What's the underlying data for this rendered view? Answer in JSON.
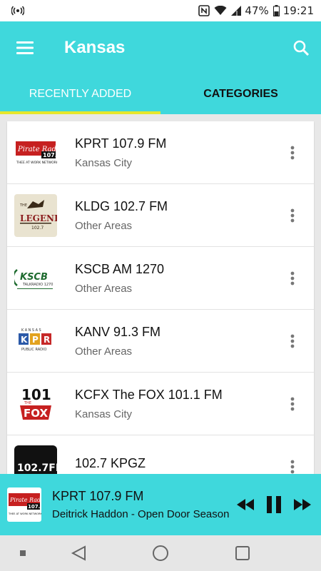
{
  "status_bar": {
    "battery_percent": "47%",
    "time": "19:21",
    "icons": [
      "broadcast-icon",
      "nfc-icon",
      "wifi-icon",
      "signal-icon",
      "battery-icon"
    ]
  },
  "app_bar": {
    "title": "Kansas",
    "menu_icon": "hamburger-menu-icon",
    "search_icon": "search-icon"
  },
  "tabs": [
    {
      "label": "RECENTLY ADDED",
      "active": true
    },
    {
      "label": "CATEGORIES",
      "active": false
    }
  ],
  "stations": [
    {
      "name": "KPRT 107.9 FM",
      "location": "Kansas City",
      "logo": "pirate-radio-logo"
    },
    {
      "name": "KLDG 102.7 FM",
      "location": "Other Areas",
      "logo": "the-legend-logo"
    },
    {
      "name": "KSCB AM 1270",
      "location": "Other Areas",
      "logo": "kscb-logo"
    },
    {
      "name": "KANV 91.3 FM",
      "location": "Other Areas",
      "logo": "kansas-public-radio-logo"
    },
    {
      "name": "KCFX The FOX 101.1 FM",
      "location": "Kansas City",
      "logo": "101-the-fox-logo"
    },
    {
      "name": "102.7 KPGZ",
      "location": "",
      "logo": "1027fm-logo"
    }
  ],
  "player": {
    "station": "KPRT 107.9 FM",
    "track": "Deitrick Haddon - Open Door Season",
    "controls": [
      "rewind-icon",
      "pause-icon",
      "fast-forward-icon"
    ]
  },
  "colors": {
    "accent": "#3fd8dc",
    "tab_indicator": "#e6e62c",
    "text_dark": "#111111",
    "text_secondary": "#666666"
  }
}
